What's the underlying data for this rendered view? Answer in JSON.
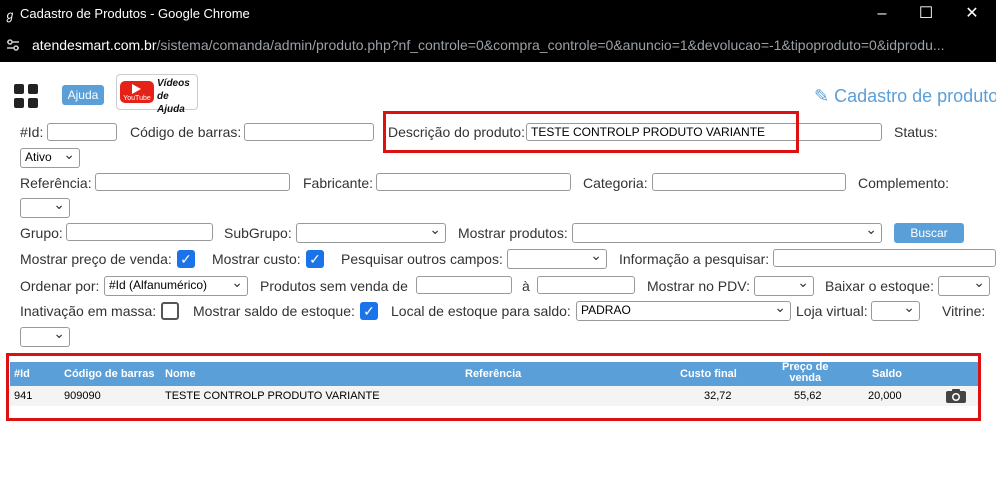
{
  "browser": {
    "window_title": "Cadastro de Produtos - Google Chrome",
    "url_host": "atendesmart.com.br",
    "url_path": "/sistema/comanda/admin/produto.php?nf_controle=0&compra_controle=0&anuncio=1&devolucao=-1&tipoproduto=0&idprodu..."
  },
  "header": {
    "help_label": "Ajuda",
    "youtube_small": "YouTube",
    "videos_label_1": "Vídeos",
    "videos_label_2": "de Ajuda",
    "page_title": "Cadastro de produto"
  },
  "filters": {
    "id_label": "#Id:",
    "id_value": "",
    "barcode_label": "Código de barras:",
    "barcode_value": "",
    "description_label": "Descrição do produto:",
    "description_value": "TESTE CONTROLP PRODUTO VARIANTE",
    "status_label": "Status:",
    "status_value": "Ativo",
    "reference_label": "Referência:",
    "manufacturer_label": "Fabricante:",
    "category_label": "Categoria:",
    "complement_label": "Complemento:",
    "group_label": "Grupo:",
    "subgroup_label": "SubGrupo:",
    "show_products_label": "Mostrar produtos:",
    "search_button": "Buscar",
    "show_sale_price_label": "Mostrar preço de venda:",
    "show_cost_label": "Mostrar custo:",
    "search_other_fields_label": "Pesquisar outros campos:",
    "info_to_search_label": "Informação a pesquisar:",
    "order_by_label": "Ordenar por:",
    "order_by_value": "#Id (Alfanumérico)",
    "products_without_sale_label": "Produtos sem venda de",
    "to_label": "à",
    "show_in_pdv_label": "Mostrar no PDV:",
    "lower_stock_label": "Baixar o estoque:",
    "mass_inactivation_label": "Inativação em massa:",
    "show_stock_balance_label": "Mostrar saldo de estoque:",
    "stock_location_label": "Local de estoque para saldo:",
    "stock_location_value": "PADRAO",
    "virtual_store_label": "Loja virtual:",
    "showcase_label": "Vitrine:"
  },
  "table": {
    "headers": {
      "id": "#Id",
      "barcode": "Código de barras",
      "name": "Nome",
      "reference": "Referência",
      "final_cost": "Custo final",
      "sale_price_1": "Preço de",
      "sale_price_2": "venda",
      "balance": "Saldo"
    },
    "rows": [
      {
        "id": "941",
        "barcode": "909090",
        "name": "TESTE CONTROLP PRODUTO VARIANTE",
        "reference": "",
        "final_cost": "32,72",
        "sale_price": "55,62",
        "balance": "20,000"
      }
    ]
  },
  "colors": {
    "accent": "#5a9fd8",
    "highlight_border": "#dd1111",
    "checkbox": "#1a73e8"
  }
}
